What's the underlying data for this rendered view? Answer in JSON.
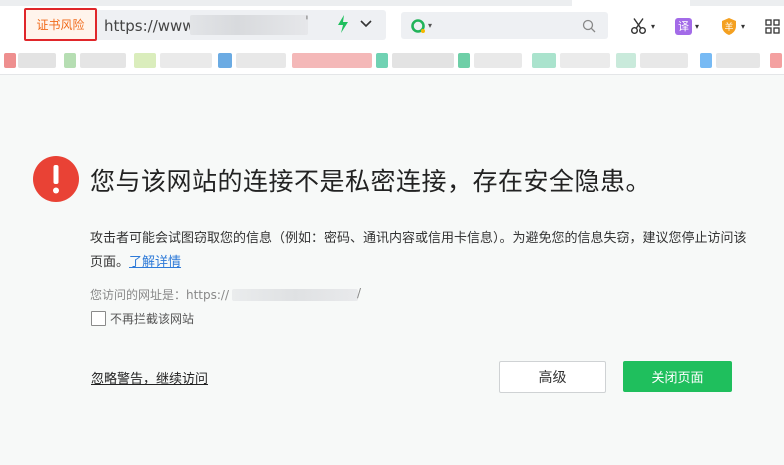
{
  "toolbar": {
    "cert_badge": "证书风险",
    "url_prefix": "https://www",
    "url_tick": "'",
    "translate_label": "译",
    "guard_label": "羊"
  },
  "icons": {
    "bolt": "lightning-icon",
    "chevron": "chevron-down-icon",
    "search_engine": "search-engine-icon",
    "search": "search-icon",
    "scissors": "scissors-icon",
    "translate": "translate-icon",
    "guard": "shield-icon",
    "apps": "grid-icon",
    "warning": "warning-icon"
  },
  "colors": {
    "cert_badge_border": "#e0262a",
    "cert_badge_text": "#f06a1b",
    "bolt": "#1fbf5d",
    "warning": "#e94235",
    "link": "#2e7ad8",
    "close_button": "#1fbf5d",
    "translate_bg": "#a36be8",
    "guard_bg": "#f4a020"
  },
  "warning": {
    "headline": "您与该网站的连接不是私密连接，存在安全隐患。",
    "description": "攻击者可能会试图窃取您的信息（例如：密码、通讯内容或信用卡信息）。为避免您的信息失窃，建议您停止访问该页面。",
    "learn_more": "了解详情",
    "visited_prefix": "您访问的网址是：https://",
    "visited_suffix": "/",
    "dont_block_label": "不再拦截该网站",
    "ignore_link": "忽略警告，继续访问",
    "advanced_button": "高级",
    "close_button": "关闭页面"
  }
}
